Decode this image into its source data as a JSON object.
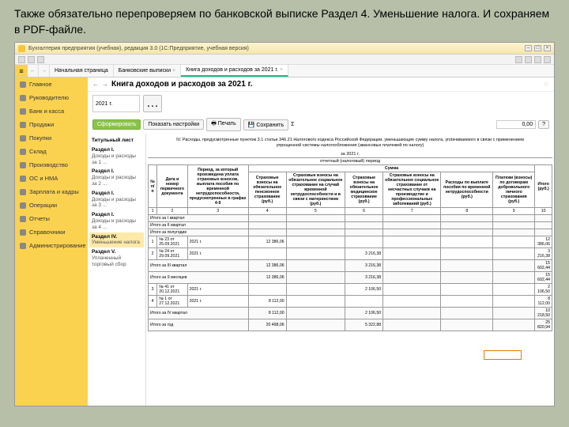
{
  "caption": "Также обязательно перепроверяем по банковской выписке Раздел 4. Уменьшение налога. И сохраняем в PDF-файле.",
  "titlebar": "Бухгалтерия предприятия (учебная), редакция 3.0  (1С:Предприятие, учебная версия)",
  "tabs": {
    "home": "Начальная страница",
    "bank": "Банковские выписки",
    "book": "Книга доходов и расходов за 2021 г."
  },
  "sidebar": [
    "Главное",
    "Руководителю",
    "Банк и касса",
    "Продажи",
    "Покупки",
    "Склад",
    "Производство",
    "ОС и НМА",
    "Зарплата и кадры",
    "Операции",
    "Отчеты",
    "Справочники",
    "Администрирование"
  ],
  "header": {
    "title": "Книга доходов и расходов за 2021 г."
  },
  "period": {
    "value": "2021 г."
  },
  "actions": {
    "form": "Сформировать",
    "settings": "Показать настройки",
    "print": "Печать",
    "save": "Сохранить",
    "sum": "0,00"
  },
  "sections": [
    {
      "t": "Титульный лист"
    },
    {
      "t": "Раздел I.",
      "s": "Доходы и расходы за 1 ..."
    },
    {
      "t": "Раздел I.",
      "s": "Доходы и расходы за 2 ..."
    },
    {
      "t": "Раздел I.",
      "s": "Доходы и расходы за 3 ..."
    },
    {
      "t": "Раздел I.",
      "s": "Доходы и расходы за 4 ..."
    },
    {
      "t": "Раздел IV.",
      "s": "Уменьшение налога",
      "active": true
    },
    {
      "t": "Раздел V.",
      "s": "Уплаченный торговый сбор"
    }
  ],
  "report": {
    "title": "IV. Расходы, предусмотренные пунктом 3.1 статьи 346.21 Налогового кодекса Российской Федерации, уменьшающие сумму налога, уплачиваемого в связи с применением упрощенной системы налогообложения (авансовых платежей по налогу)",
    "subtitle_label": "за 2021 г.",
    "subtitle_type": "отчетный (налоговый) период",
    "head": {
      "c1": "№ п/п",
      "c2": "Дата и номер первичного документа",
      "c3": "Период, за который произведена уплата страховых взносов, выплата пособия по временной нетрудоспособности, предусмотренных в графах 4-9",
      "sumhdr": "Сумма",
      "c4": "Страховые взносы на обязательное пенсионное страхование (руб.)",
      "c5": "Страховые взносы на обязательное социальное страхование на случай временной нетрудоспособности и в связи с материнством (руб.)",
      "c6": "Страховые взносы на обязательное медицинское страхование (руб.)",
      "c7": "Страховые взносы на обязательное социальное страхование от несчастных случаев на производстве и профессиональных заболеваний (руб.)",
      "c8": "Расходы по выплате пособия по временной нетрудоспособности (руб.)",
      "c9": "Платежи (взносы) по договорам добровольного личного страхования (руб.)",
      "c10": "Итого (руб.)"
    },
    "numrow": [
      "1",
      "2",
      "3",
      "4",
      "5",
      "6",
      "7",
      "8",
      "9",
      "10"
    ],
    "rows": [
      {
        "label": "Итого за I квартал"
      },
      {
        "label": "Итого за II квартал"
      },
      {
        "label": "Итого за полугодие"
      },
      {
        "n": "1",
        "doc": "№ 23 от 25.09.2021",
        "per": "2021 г.",
        "c4": "12 386,06",
        "c10": "12 386,06"
      },
      {
        "n": "2",
        "doc": "№ 24 от 29.09.2021",
        "per": "2021 г.",
        "c6": "3 216,38",
        "c10": "3 216,38"
      },
      {
        "label": "Итого за III квартал",
        "c4": "12 386,06",
        "c6": "3 216,38",
        "c10": "15 602,44"
      },
      {
        "label": "Итого за 9 месяцев",
        "c4": "12 386,06",
        "c6": "3 216,38",
        "c10": "15 602,44"
      },
      {
        "n": "3",
        "doc": "№ 41 от 20.12.2021",
        "per": "2021 г.",
        "c6": "2 106,50",
        "c10": "2 106,50"
      },
      {
        "n": "4",
        "doc": "№ 1 от 27.12.2021",
        "per": "2021 г.",
        "c4": "8 112,00",
        "c10": "8 112,00"
      },
      {
        "label": "Итого за IV квартал",
        "c4": "8 112,00",
        "c6": "2 106,50",
        "c10": "10 218,50"
      },
      {
        "label": "Итого за год",
        "c4": "20 498,06",
        "c6": "5 322,88",
        "c10": "25 820,94"
      }
    ]
  }
}
